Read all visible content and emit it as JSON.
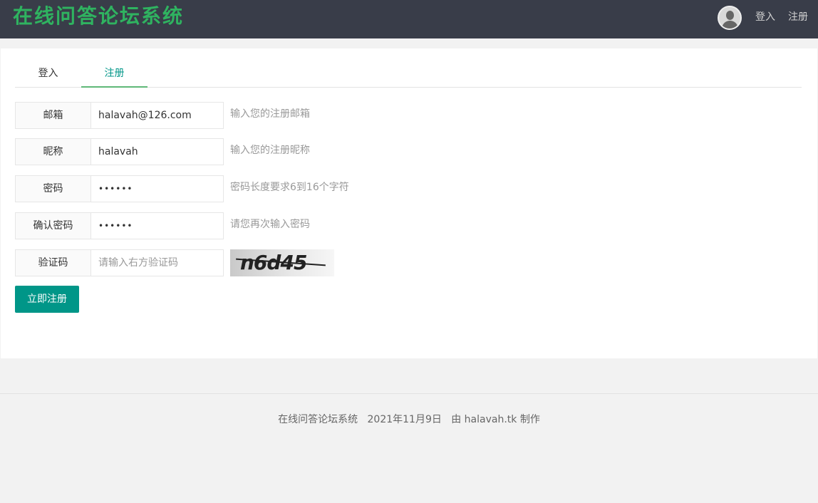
{
  "header": {
    "logo": "在线问答论坛系统",
    "avatar_icon": "user-avatar-icon",
    "nav_login": "登入",
    "nav_register": "注册"
  },
  "tabs": [
    {
      "label": "登入",
      "active": false
    },
    {
      "label": "注册",
      "active": true
    }
  ],
  "form": {
    "email": {
      "label": "邮箱",
      "value": "halavah@126.com",
      "hint": "输入您的注册邮箱"
    },
    "nickname": {
      "label": "昵称",
      "value": "halavah",
      "hint": "输入您的注册昵称"
    },
    "password": {
      "label": "密码",
      "value": "••••••",
      "hint": "密码长度要求6到16个字符"
    },
    "confirm_password": {
      "label": "确认密码",
      "value": "••••••",
      "hint": "请您再次输入密码"
    },
    "captcha": {
      "label": "验证码",
      "placeholder": "请输入右方验证码",
      "image_text": "n6d45"
    },
    "submit_label": "立即注册"
  },
  "footer": {
    "text": "在线问答论坛系统   2021年11月9日   由 halavah.tk 制作"
  },
  "colors": {
    "header_bg": "#393d49",
    "logo": "#2fb360",
    "accent": "#009688",
    "tab_underline": "#5FB878"
  }
}
